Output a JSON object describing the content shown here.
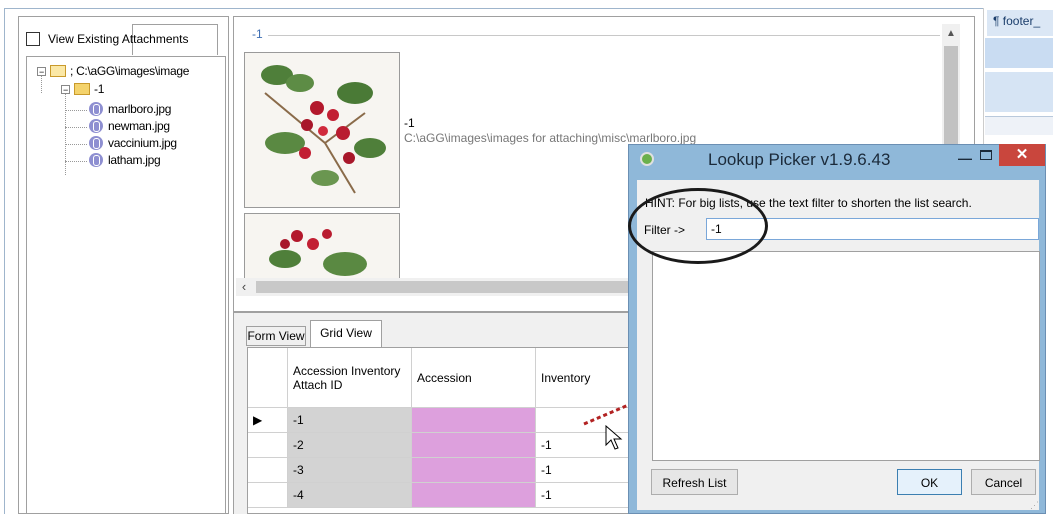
{
  "left_panel": {
    "view_existing_label": "View Existing Attachments",
    "tree": {
      "root_label": "; C:\\aGG\\images\\image",
      "child_label": "-1",
      "files": [
        "marlboro.jpg",
        "newman.jpg",
        "vaccinium.jpg",
        "latham.jpg"
      ]
    }
  },
  "image_panel": {
    "group_label": "-1",
    "selected_id": "-1",
    "selected_path": "C:\\aGG\\images\\images for attaching\\misc\\marlboro.jpg"
  },
  "right_strip": {
    "footer_label": "¶ footer_"
  },
  "tabs": {
    "form_view": "Form View",
    "grid_view": "Grid View"
  },
  "grid": {
    "headers": [
      "Accession Inventory Attach ID",
      "Accession",
      "Inventory"
    ],
    "rows": [
      {
        "id": "-1",
        "accession": "",
        "inventory": ""
      },
      {
        "id": "-2",
        "accession": "",
        "inventory": "-1"
      },
      {
        "id": "-3",
        "accession": "",
        "inventory": "-1"
      },
      {
        "id": "-4",
        "accession": "",
        "inventory": "-1"
      }
    ],
    "current_row_marker": "▶"
  },
  "dialog": {
    "title": "Lookup Picker v1.9.6.43",
    "hint": "HINT: For big lists, use the text filter to shorten the list search.",
    "filter_label": "Filter ->",
    "filter_value": "-1",
    "refresh_button": "Refresh List",
    "ok_button": "OK",
    "cancel_button": "Cancel",
    "close_glyph": "✕",
    "minimize_glyph": "—"
  },
  "colors": {
    "accession_cell": "#dda0dd",
    "id_cell": "#d3d3d3",
    "dialog_frame": "#8fb8d9",
    "close_button": "#c9463d"
  }
}
